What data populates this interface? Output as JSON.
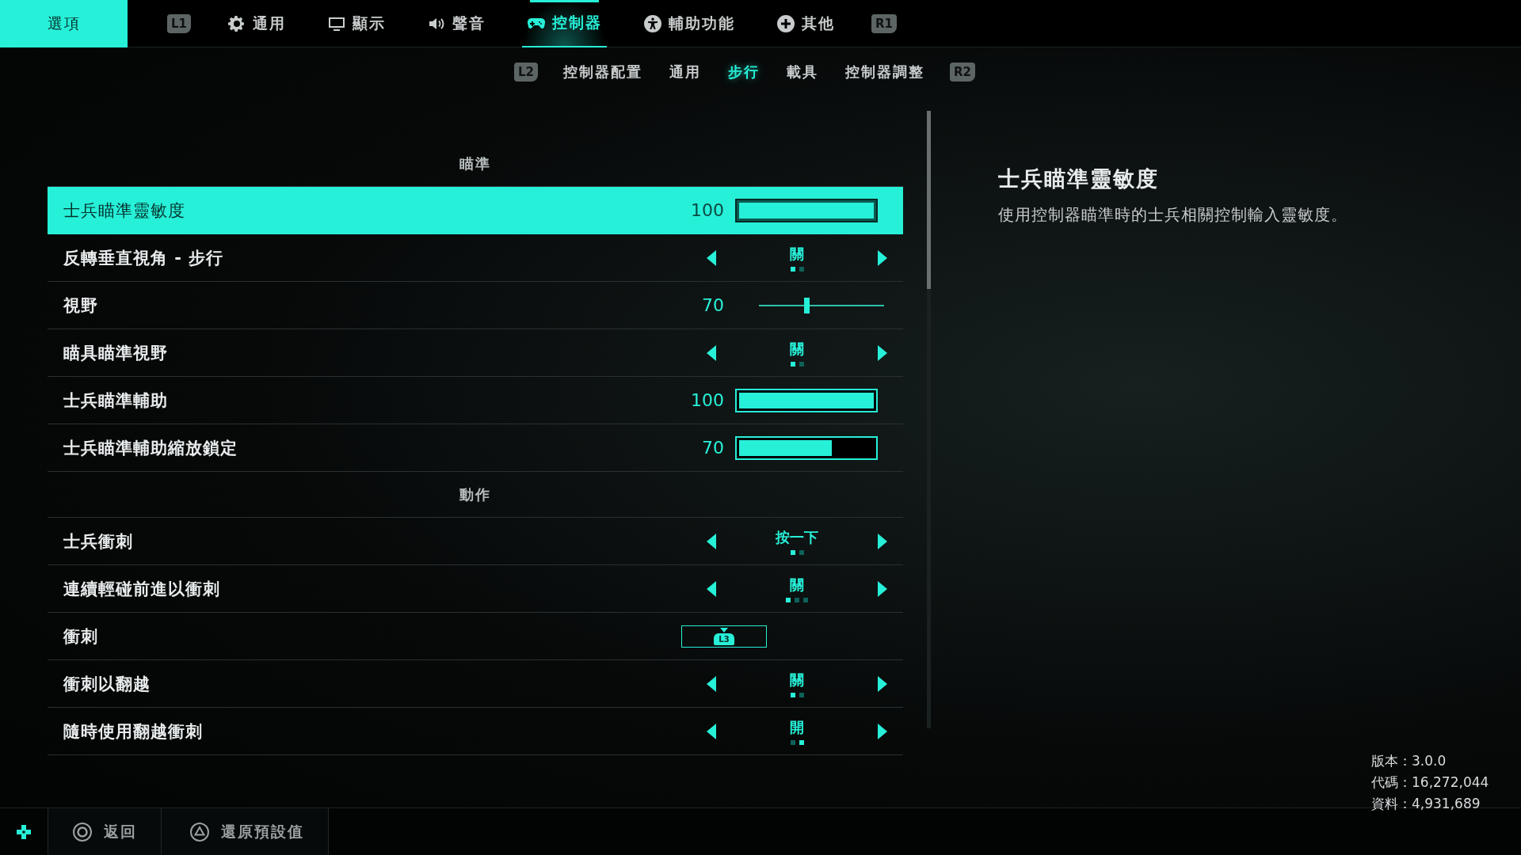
{
  "header": {
    "title": "選項",
    "left_key": "L1",
    "right_key": "R1",
    "tabs": [
      {
        "label": "通用",
        "kind": "gear",
        "selected": false
      },
      {
        "label": "顯示",
        "kind": "monitor",
        "selected": false
      },
      {
        "label": "聲音",
        "kind": "speaker",
        "selected": false
      },
      {
        "label": "控制器",
        "kind": "gamepad",
        "selected": true
      },
      {
        "label": "輔助功能",
        "kind": "accessibility",
        "selected": false
      },
      {
        "label": "其他",
        "kind": "plus",
        "selected": false
      }
    ]
  },
  "subtab_keys": {
    "left": "L2",
    "right": "R2"
  },
  "subtabs": [
    {
      "label": "控制器配置",
      "selected": false
    },
    {
      "label": "通用",
      "selected": false
    },
    {
      "label": "步行",
      "selected": true
    },
    {
      "label": "載具",
      "selected": false
    },
    {
      "label": "控制器調整",
      "selected": false
    }
  ],
  "settings": [
    {
      "kind": "section",
      "label": "瞄準"
    },
    {
      "kind": "bar",
      "label": "士兵瞄準靈敏度",
      "reading": "100",
      "level": 1.0,
      "selected": true
    },
    {
      "kind": "selector",
      "label": "反轉垂直視角 - 步行",
      "value": "關",
      "dots": [
        {
          "selected": true
        },
        {
          "selected": false
        }
      ],
      "selected": false
    },
    {
      "kind": "slider",
      "label": "視野",
      "reading": "70",
      "level": 0.38,
      "selected": false
    },
    {
      "kind": "selector",
      "label": "瞄具瞄準視野",
      "value": "關",
      "dots": [
        {
          "selected": true
        },
        {
          "selected": false
        }
      ],
      "selected": false
    },
    {
      "kind": "bar",
      "label": "士兵瞄準輔助",
      "reading": "100",
      "level": 1.0,
      "selected": false
    },
    {
      "kind": "bar",
      "label": "士兵瞄準輔助縮放鎖定",
      "reading": "70",
      "level": 0.69,
      "selected": false
    },
    {
      "kind": "section",
      "label": "動作"
    },
    {
      "kind": "selector",
      "label": "士兵衝刺",
      "value": "按一下",
      "dots": [
        {
          "selected": true
        },
        {
          "selected": false
        }
      ],
      "selected": false
    },
    {
      "kind": "selector",
      "label": "連續輕碰前進以衝刺",
      "value": "關",
      "dots": [
        {
          "selected": true
        },
        {
          "selected": false
        },
        {
          "selected": false
        }
      ],
      "selected": false
    },
    {
      "kind": "keybind",
      "label": "衝刺",
      "key": "L3",
      "selected": false
    },
    {
      "kind": "selector",
      "label": "衝刺以翻越",
      "value": "關",
      "dots": [
        {
          "selected": true
        },
        {
          "selected": false
        }
      ],
      "selected": false
    },
    {
      "kind": "selector",
      "label": "隨時使用翻越衝刺",
      "value": "開",
      "dots": [
        {
          "selected": false
        },
        {
          "selected": true
        }
      ],
      "selected": false
    }
  ],
  "description": {
    "title": "士兵瞄準靈敏度",
    "text": "使用控制器瞄準時的士兵相關控制輸入靈敏度。"
  },
  "build_info": [
    "版本：3.0.0",
    "代碼：16,272,044",
    "資料：4,931,689"
  ],
  "footer": [
    {
      "label": "返回",
      "kind": "circle"
    },
    {
      "label": "還原預設值",
      "kind": "triangle"
    }
  ]
}
